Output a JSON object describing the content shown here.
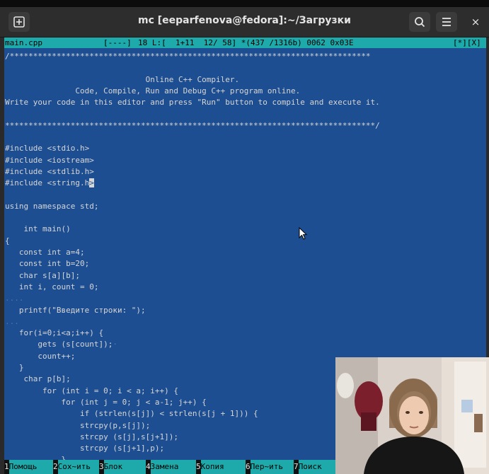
{
  "window": {
    "title": "mc [eeparfenova@fedora]:~/Загрузки",
    "new_tab_icon": "new-tab-icon",
    "search_icon": "search-icon",
    "menu_icon": "hamburger-menu-icon",
    "close_symbol": "×"
  },
  "status": {
    "filename": "main.cpp",
    "flags": "[----]",
    "position": "18 L:[  1+11  12/ 58] *(437 /1316b) 0062 0x03E",
    "mode": "[*][X]"
  },
  "editor": {
    "lines": [
      "/*****************************************************************************",
      "",
      "                              Online C++ Compiler.",
      "               Code, Compile, Run and Debug C++ program online.",
      "Write your code in this editor and press \"Run\" button to compile and execute it.",
      "",
      "*******************************************************************************/",
      "",
      "#include <stdio.h>",
      "#include <iostream>",
      "#include <stdlib.h>",
      "#include <string.h",
      "",
      "using namespace std;",
      "",
      "    int main()",
      "{",
      "   const int a=4;",
      "   const int b=20;",
      "   char s[a][b];",
      "   int i, count = 0;",
      "",
      "   printf(\"Введите строки: \");",
      "",
      "   for(i=0;i<a;i++) {",
      "       gets (s[count]);",
      "       count++;",
      "   }",
      "    char p[b];",
      "        for (int i = 0; i < a; i++) {",
      "            for (int j = 0; j < a-1; j++) {",
      "                if (strlen(s[j]) < strlen(s[j + 1])) {",
      "                strcpy(p,s[j]);",
      "                strcpy (s[j],s[j+1]);",
      "                strcpy (s[j+1],p);",
      "            }"
    ],
    "cursor_char": ">",
    "whitespace_marks": [
      "....",
      "·",
      "..."
    ]
  },
  "keys": [
    {
      "num": "1",
      "label": "Помощь"
    },
    {
      "num": "2",
      "label": "Сох~ить"
    },
    {
      "num": "3",
      "label": "Блок"
    },
    {
      "num": "4",
      "label": "Замена"
    },
    {
      "num": "5",
      "label": "Копия"
    },
    {
      "num": "6",
      "label": "Пер~ить"
    },
    {
      "num": "7",
      "label": "Поиск"
    }
  ],
  "colors": {
    "editor_bg": "#1d4e91",
    "status_bg": "#1eaaaa",
    "titlebar_bg": "#2d2d2d"
  },
  "overlay": {
    "webcam": "webcam video thumbnail of a person"
  }
}
